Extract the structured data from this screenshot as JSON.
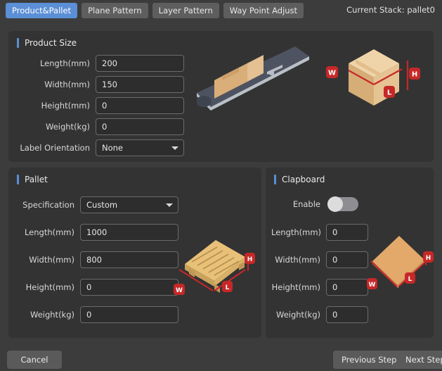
{
  "header": {
    "tabs": [
      {
        "label": "Product&Pallet",
        "active": true
      },
      {
        "label": "Plane Pattern",
        "active": false
      },
      {
        "label": "Layer Pattern",
        "active": false
      },
      {
        "label": "Way Point Adjust",
        "active": false
      }
    ],
    "current_stack": "Current Stack: pallet0",
    "active_tab_color": "#5b8fd6"
  },
  "product_size": {
    "title": "Product Size",
    "fields": [
      {
        "label": "Length(mm)",
        "value": "200"
      },
      {
        "label": "Width(mm)",
        "value": "150"
      },
      {
        "label": "Height(mm)",
        "value": "0"
      },
      {
        "label": "Weight(kg)",
        "value": "0"
      }
    ],
    "label_orientation": {
      "label": "Label Orientation",
      "value": "None"
    },
    "dim_markers": {
      "w": "W",
      "h": "H",
      "l": "L"
    }
  },
  "pallet": {
    "title": "Pallet",
    "specification": {
      "label": "Specification",
      "value": "Custom"
    },
    "fields": [
      {
        "label": "Length(mm)",
        "value": "1000"
      },
      {
        "label": "Width(mm)",
        "value": "800"
      },
      {
        "label": "Height(mm)",
        "value": "0"
      },
      {
        "label": "Weight(kg)",
        "value": "0"
      }
    ],
    "dim_markers": {
      "w": "W",
      "h": "H",
      "l": "L"
    }
  },
  "clapboard": {
    "title": "Clapboard",
    "enable": {
      "label": "Enable",
      "state": "off"
    },
    "fields": [
      {
        "label": "Length(mm)",
        "value": "0"
      },
      {
        "label": "Width(mm)",
        "value": "0"
      },
      {
        "label": "Height(mm)",
        "value": "0"
      },
      {
        "label": "Weight(kg)",
        "value": "0"
      }
    ],
    "dim_markers": {
      "w": "W",
      "h": "H",
      "l": "L"
    }
  },
  "footer": {
    "cancel": "Cancel",
    "previous": "Previous Step",
    "next": "Next Step"
  },
  "colors": {
    "background": "#3c3c3c",
    "panel": "#333333",
    "accent": "#5b8fd6",
    "marker_red": "#c62828",
    "carton": "#e8c48f"
  }
}
